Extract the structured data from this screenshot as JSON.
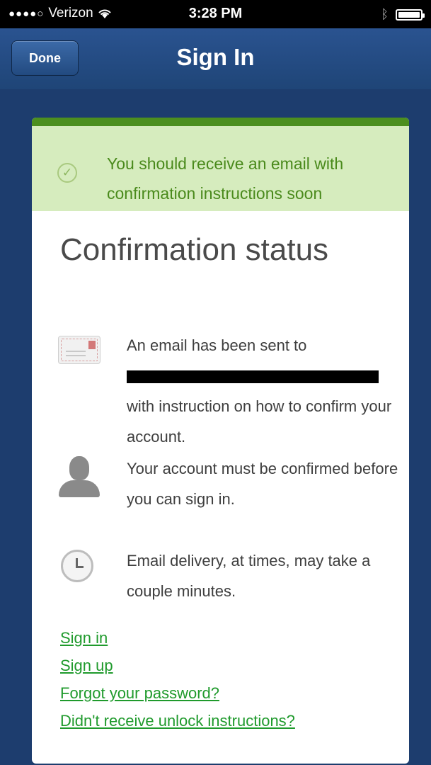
{
  "status_bar": {
    "signal": "●●●●○",
    "carrier": "Verizon",
    "wifi_icon": "wifi-icon",
    "time": "3:28 PM",
    "bluetooth_icon": "bluetooth-icon",
    "battery_icon": "battery-icon"
  },
  "nav": {
    "done_label": "Done",
    "title": "Sign In"
  },
  "alert": {
    "icon": "check-circle-icon",
    "message": "You should receive an email with confirmation instructions soon",
    "colors": {
      "background": "#d6ecbe",
      "border": "#4c8f1f",
      "text": "#4a8a1c"
    }
  },
  "main": {
    "heading": "Confirmation status",
    "items": [
      {
        "icon": "envelope-icon",
        "text_before": "An email has been sent to",
        "text_after": "with instruction on how to confirm your account."
      },
      {
        "icon": "person-icon",
        "text": "Your account must be confirmed before you can sign in."
      },
      {
        "icon": "clock-icon",
        "text": "Email delivery, at times, may take a couple minutes."
      }
    ]
  },
  "links": [
    {
      "label": "Sign in"
    },
    {
      "label": "Sign up"
    },
    {
      "label": "Forgot your password?"
    },
    {
      "label": "Didn't receive unlock instructions?"
    }
  ],
  "colors": {
    "nav_background": "#1f4577",
    "link": "#1f9a2c"
  }
}
